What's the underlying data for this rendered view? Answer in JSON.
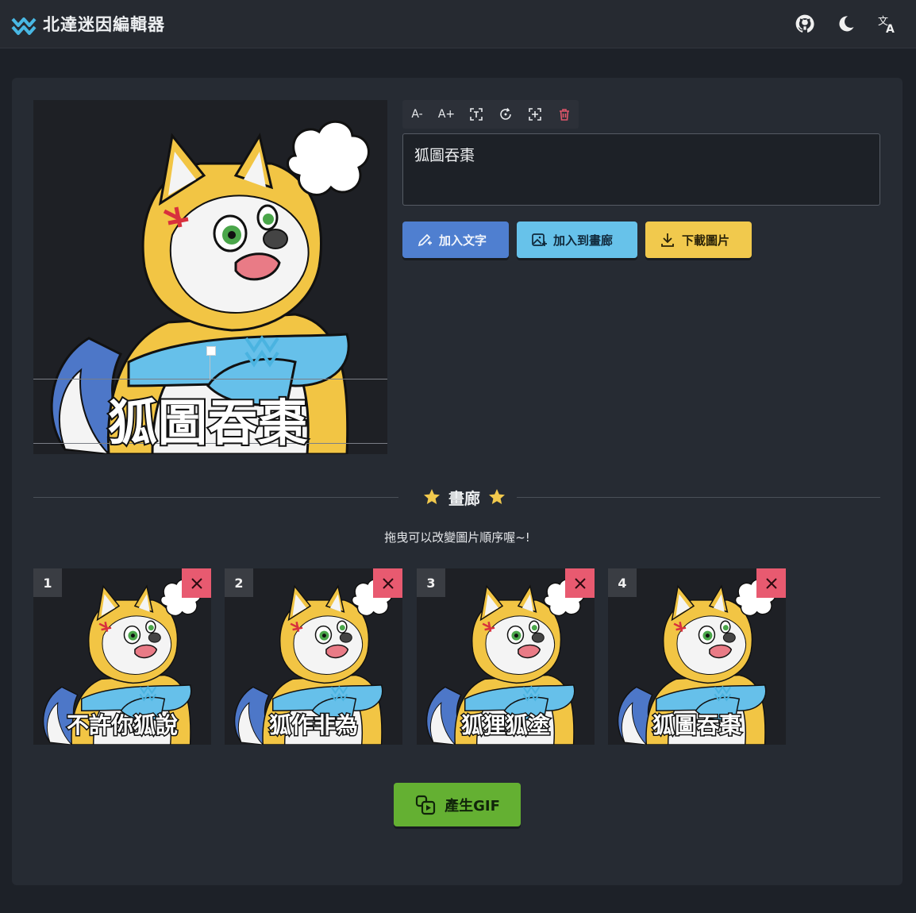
{
  "app": {
    "title": "北達迷因編輯器"
  },
  "header_icons": [
    "github-icon",
    "moon-icon",
    "translate-icon"
  ],
  "editor": {
    "caption_on_canvas": "狐圖吞棗",
    "toolbar": [
      {
        "label": "A-",
        "icon": "font-decrease-icon"
      },
      {
        "label": "A+",
        "icon": "font-increase-icon"
      },
      {
        "label": "",
        "icon": "text-frame-icon"
      },
      {
        "label": "",
        "icon": "rotate-icon"
      },
      {
        "label": "",
        "icon": "center-icon"
      },
      {
        "label": "",
        "icon": "trash-icon"
      }
    ],
    "text_value": "狐圖吞棗",
    "buttons": {
      "add_text": "加入文字",
      "add_gallery": "加入到畫廊",
      "download": "下載圖片"
    }
  },
  "gallery": {
    "title": "畫廊",
    "hint": "拖曳可以改變圖片順序喔~!",
    "items": [
      {
        "index": "1",
        "caption": "不許你狐說"
      },
      {
        "index": "2",
        "caption": "狐作非為"
      },
      {
        "index": "3",
        "caption": "狐狸狐塗"
      },
      {
        "index": "4",
        "caption": "狐圖吞棗"
      }
    ],
    "generate_label": "產生GIF"
  },
  "colors": {
    "accent_blue": "#4f7fd0",
    "accent_cyan": "#67c2ea",
    "accent_yellow": "#f1c94d",
    "accent_green": "#64b032",
    "danger": "#e85a70",
    "logo": "#49b8e4"
  }
}
